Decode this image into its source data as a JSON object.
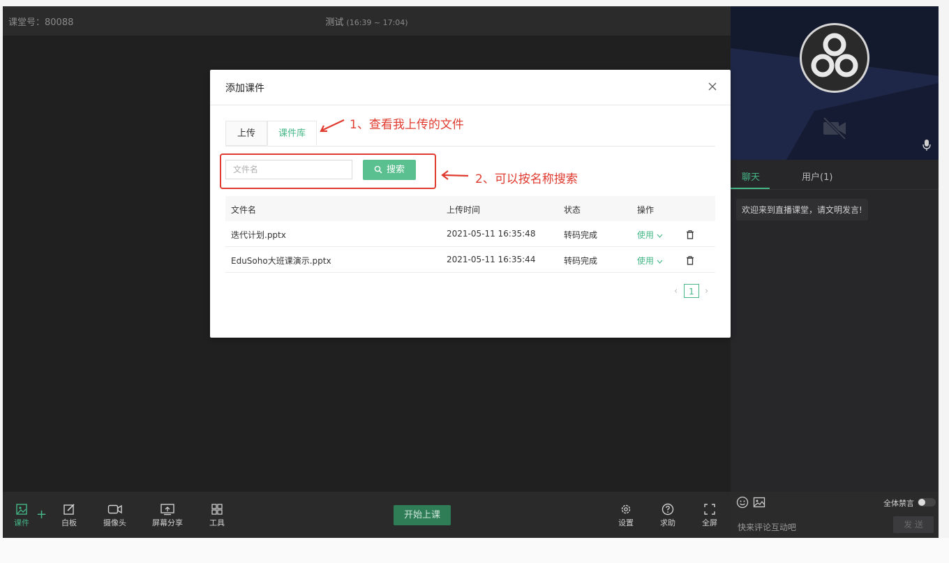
{
  "header": {
    "room_number": "课堂号：80088",
    "course_title": "测试",
    "course_time": "(16:39 ~ 17:04)"
  },
  "modal": {
    "title": "添加课件",
    "tabs": [
      {
        "label": "上传"
      },
      {
        "label": "课件库"
      }
    ],
    "search": {
      "placeholder": "文件名",
      "button_label": "搜索"
    },
    "table": {
      "columns": [
        "文件名",
        "上传时间",
        "状态",
        "操作"
      ],
      "rows": [
        {
          "name": "迭代计划.pptx",
          "uploaded": "2021-05-11 16:35:48",
          "status": "转码完成",
          "action": "使用"
        },
        {
          "name": "EduSoho大班课演示.pptx",
          "uploaded": "2021-05-11 16:35:44",
          "status": "转码完成",
          "action": "使用"
        }
      ]
    },
    "pagination": {
      "current": "1"
    }
  },
  "annotations": {
    "note1": "1、查看我上传的文件",
    "note2": "2、可以按名称搜索",
    "color": "#e03a2f"
  },
  "toolbar": {
    "items": [
      {
        "label": "课件",
        "icon": "image-icon"
      },
      {
        "label": "白板",
        "icon": "edit-icon"
      },
      {
        "label": "摄像头",
        "icon": "camera-icon"
      },
      {
        "label": "屏幕分享",
        "icon": "screen-share-icon"
      },
      {
        "label": "工具",
        "icon": "grid-icon"
      }
    ],
    "start_label": "开始上课",
    "right_items": [
      {
        "label": "设置",
        "icon": "gear-icon"
      },
      {
        "label": "求助",
        "icon": "help-icon"
      },
      {
        "label": "全屏",
        "icon": "fullscreen-icon"
      }
    ]
  },
  "sidebar": {
    "tabs": [
      {
        "label": "聊天"
      },
      {
        "label": "用户(1)"
      }
    ],
    "welcome_message": "欢迎来到直播课堂，请文明发言!",
    "mute_all_label": "全体禁言",
    "chat_placeholder": "快来评论互动吧",
    "send_label": "发 送"
  },
  "colors": {
    "accent": "#45b787",
    "dark_bg": "#252526",
    "annotation": "#e03a2f"
  }
}
